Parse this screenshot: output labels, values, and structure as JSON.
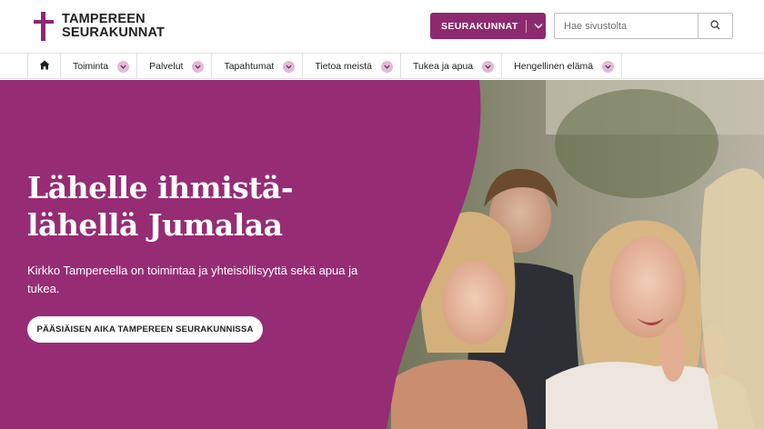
{
  "header": {
    "logo_line1": "TAMPEREEN",
    "logo_line2": "SEURAKUNNAT",
    "seurakunnat_button": "SEURAKUNNAT",
    "search_placeholder": "Hae sivustolta",
    "brand_color": "#8c2a6d"
  },
  "nav": {
    "home_icon": "home-icon",
    "items": [
      {
        "label": "Toiminta"
      },
      {
        "label": "Palvelut"
      },
      {
        "label": "Tapahtumat"
      },
      {
        "label": "Tietoa meistä"
      },
      {
        "label": "Tukea ja apua"
      },
      {
        "label": "Hengellinen elämä"
      }
    ],
    "chevron_color": "#e2b9d6"
  },
  "hero": {
    "title_line1": "Lähelle ihmistä-",
    "title_line2": "lähellä Jumalaa",
    "subtitle": "Kirkko Tampereella on toimintaa ja yhteisöllisyyttä sekä apua ja tukea.",
    "button_label": "PÄÄSIÄISEN AIKA TAMPEREEN SEURAKUNNISSA",
    "panel_color": "#962c74"
  }
}
